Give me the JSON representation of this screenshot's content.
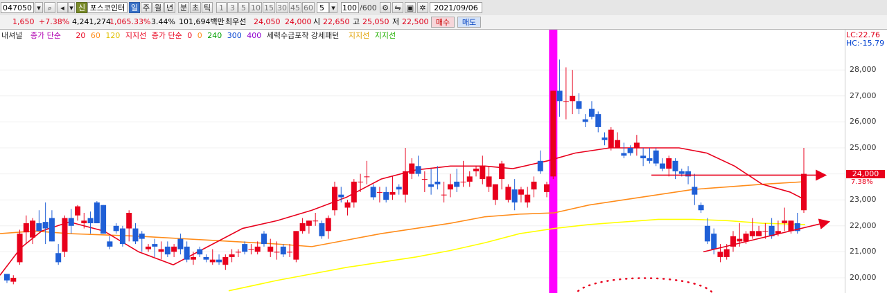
{
  "toolbar": {
    "code": "047050",
    "shin": "신",
    "name": "포스코인터",
    "periods": [
      "일",
      "주",
      "월",
      "년",
      "분",
      "초",
      "틱"
    ],
    "active_period": "일",
    "numbers": [
      "1",
      "3",
      "5",
      "10",
      "15",
      "30",
      "45",
      "60"
    ],
    "interval": "5",
    "count": "100",
    "count_total": "/600",
    "date": "2021/09/06"
  },
  "quote": {
    "change": "1,650",
    "change_pct": "+7.38%",
    "volume": "4,241,274",
    "volume_pct": "1,065.33%",
    "turnover": "3.44%",
    "amount": "101,694백만",
    "best_label": "최우선",
    "best_ask": "24,050",
    "best_bid": "24,000",
    "open_label": "시",
    "open": "22,650",
    "high_label": "고",
    "high": "25,050",
    "low_label": "저",
    "low": "22,500",
    "buy": "매수",
    "sell": "매도"
  },
  "legend": {
    "internal": "내셔널",
    "ma1_title": "종가 단순",
    "ma1_periods": [
      "20",
      "60",
      "120"
    ],
    "support1": "지지선",
    "ma2_title": "종가 단순",
    "ma2_periods": [
      "0",
      "0",
      "240",
      "300",
      "400"
    ],
    "pattern": "세력수급포착 강세패턴",
    "support2": "지지선",
    "support3": "지지선"
  },
  "axis": {
    "lc": "LC:22.76",
    "hc": "HC:-15.79",
    "current_price": "24,000",
    "current_pct": "7.38%"
  },
  "colors": {
    "up": "#e8001c",
    "down": "#1f5fd6",
    "ma20": "#e8001c",
    "ma60": "#ff8c1a",
    "ma120": "#ffff00",
    "highlight": "#ff00ff"
  },
  "chart_data": {
    "type": "candlestick",
    "y_axis_ticks": [
      "20,000",
      "21,000",
      "22,000",
      "23,000",
      "24,000",
      "25,000",
      "26,000",
      "27,000",
      "28,000"
    ],
    "ylim": [
      19400,
      29300
    ],
    "candles": [
      [
        20150,
        20150,
        19800,
        19900
      ],
      [
        19850,
        20100,
        19750,
        20000
      ],
      [
        20600,
        21850,
        20500,
        21700
      ],
      [
        21750,
        22400,
        21300,
        22100
      ],
      [
        21550,
        22300,
        21300,
        22200
      ],
      [
        22100,
        22600,
        21800,
        21800
      ],
      [
        22150,
        22900,
        21300,
        21900
      ],
      [
        22300,
        22600,
        21400,
        21400
      ],
      [
        20950,
        21300,
        20500,
        20600
      ],
      [
        21000,
        22400,
        20800,
        22300
      ],
      [
        22300,
        22650,
        21700,
        22000
      ],
      [
        22400,
        22800,
        22200,
        22750
      ],
      [
        22100,
        22500,
        21900,
        22200
      ],
      [
        22300,
        22550,
        21700,
        22100
      ],
      [
        22900,
        22950,
        22100,
        22100
      ],
      [
        22800,
        22800,
        21700,
        21700
      ],
      [
        21400,
        21600,
        21100,
        21200
      ],
      [
        22000,
        22100,
        21700,
        21800
      ],
      [
        21900,
        22000,
        21200,
        21300
      ],
      [
        21900,
        22600,
        21400,
        22500
      ],
      [
        21900,
        22100,
        21300,
        21400
      ],
      [
        21700,
        21800,
        21000,
        21500
      ],
      [
        21100,
        21300,
        21000,
        21200
      ],
      [
        21300,
        21500,
        20800,
        21200
      ],
      [
        21000,
        21400,
        20700,
        21100
      ],
      [
        21200,
        21400,
        20800,
        20900
      ],
      [
        21000,
        21300,
        20800,
        21200
      ],
      [
        21500,
        21700,
        20900,
        21100
      ],
      [
        21200,
        21400,
        20600,
        20700
      ],
      [
        20700,
        21000,
        20500,
        20800
      ],
      [
        21100,
        21200,
        20800,
        20900
      ],
      [
        20800,
        20900,
        20600,
        20700
      ],
      [
        20600,
        21100,
        20500,
        20700
      ],
      [
        20700,
        20900,
        20500,
        20600
      ],
      [
        20500,
        20900,
        20300,
        20800
      ],
      [
        20800,
        21100,
        20600,
        20900
      ],
      [
        21000,
        21100,
        20800,
        21000
      ],
      [
        21300,
        21400,
        20900,
        21000
      ],
      [
        21100,
        21300,
        20900,
        21100
      ],
      [
        21000,
        21400,
        20900,
        21200
      ],
      [
        21700,
        21800,
        21200,
        21300
      ],
      [
        21000,
        21500,
        20800,
        21200
      ],
      [
        21000,
        21400,
        20700,
        21000
      ],
      [
        21200,
        21300,
        20800,
        20900
      ],
      [
        21000,
        21300,
        20800,
        21000
      ],
      [
        20700,
        21800,
        20600,
        21800
      ],
      [
        21800,
        22300,
        21700,
        22100
      ],
      [
        22000,
        22200,
        21700,
        22200
      ],
      [
        22200,
        22500,
        22000,
        22200
      ],
      [
        22100,
        22200,
        21500,
        21600
      ],
      [
        21800,
        22400,
        21500,
        22300
      ],
      [
        22600,
        23700,
        22400,
        23500
      ],
      [
        23200,
        23500,
        22900,
        23100
      ],
      [
        22700,
        23000,
        22400,
        22900
      ],
      [
        22900,
        23800,
        22700,
        23700
      ],
      [
        23700,
        24000,
        23300,
        23700
      ],
      [
        23900,
        24500,
        23600,
        23900
      ],
      [
        23500,
        23600,
        23000,
        23100
      ],
      [
        23300,
        23500,
        22900,
        23300
      ],
      [
        23300,
        23500,
        22900,
        23000
      ],
      [
        23200,
        23900,
        23000,
        23300
      ],
      [
        23500,
        23600,
        23200,
        23400
      ],
      [
        23200,
        25000,
        22900,
        24100
      ],
      [
        24000,
        24600,
        23800,
        24400
      ],
      [
        24300,
        24700,
        23900,
        24000
      ],
      [
        23800,
        24100,
        23300,
        23800
      ],
      [
        23600,
        24200,
        23200,
        23500
      ],
      [
        23700,
        24300,
        23400,
        23600
      ],
      [
        23200,
        23700,
        22900,
        23200
      ],
      [
        23400,
        24000,
        23100,
        23600
      ],
      [
        23700,
        24200,
        23300,
        23500
      ],
      [
        23700,
        24500,
        23500,
        23700
      ],
      [
        23700,
        24100,
        23500,
        23900
      ],
      [
        24100,
        24300,
        23900,
        24200
      ],
      [
        23800,
        24700,
        23600,
        24300
      ],
      [
        23500,
        24300,
        23300,
        23900
      ],
      [
        23000,
        23600,
        22800,
        23600
      ],
      [
        23800,
        24500,
        23400,
        24400
      ],
      [
        23000,
        23600,
        22900,
        23500
      ],
      [
        23400,
        23800,
        22600,
        22900
      ],
      [
        23200,
        23500,
        22900,
        23400
      ],
      [
        22900,
        23500,
        22700,
        23200
      ],
      [
        23400,
        23900,
        23100,
        23700
      ],
      [
        24500,
        24900,
        24000,
        24100
      ],
      [
        23300,
        23700,
        23100,
        23600
      ],
      [
        23900,
        27200,
        23800,
        27200
      ],
      [
        27200,
        28400,
        26200,
        26800
      ],
      [
        26800,
        28100,
        26100,
        26800
      ],
      [
        26800,
        28000,
        26300,
        27000
      ],
      [
        26800,
        27100,
        26300,
        26500
      ],
      [
        26100,
        26300,
        25800,
        26000
      ],
      [
        26500,
        26800,
        26100,
        26200
      ],
      [
        26300,
        26400,
        25600,
        25800
      ],
      [
        25400,
        25600,
        25100,
        25300
      ],
      [
        25000,
        25800,
        24900,
        25700
      ],
      [
        25000,
        25600,
        25200,
        25300
      ],
      [
        24800,
        25200,
        24600,
        24700
      ],
      [
        25000,
        25100,
        24700,
        24800
      ],
      [
        25000,
        25500,
        24700,
        25200
      ],
      [
        24700,
        25000,
        24300,
        24600
      ],
      [
        24600,
        25000,
        24400,
        24500
      ],
      [
        24900,
        25000,
        24300,
        24400
      ],
      [
        24400,
        24600,
        24100,
        24200
      ],
      [
        24200,
        24700,
        23900,
        24600
      ],
      [
        24500,
        24600,
        23800,
        24100
      ],
      [
        24100,
        24200,
        23900,
        24000
      ],
      [
        24100,
        24300,
        23600,
        23900
      ],
      [
        23500,
        24000,
        22800,
        23200
      ],
      [
        22800,
        22900,
        22500,
        22600
      ],
      [
        22000,
        22300,
        21300,
        21400
      ],
      [
        21700,
        21900,
        20900,
        21100
      ],
      [
        20800,
        21300,
        20600,
        21000
      ],
      [
        20800,
        21300,
        20700,
        21100
      ],
      [
        21200,
        21800,
        21000,
        21600
      ],
      [
        21400,
        22100,
        21200,
        21500
      ],
      [
        21400,
        21800,
        21300,
        21700
      ],
      [
        21600,
        22300,
        21500,
        21800
      ],
      [
        21600,
        22000,
        21600,
        21800
      ],
      [
        21800,
        22100,
        21500,
        21800
      ],
      [
        22000,
        22300,
        21500,
        21600
      ],
      [
        21700,
        22200,
        21600,
        21800
      ],
      [
        22100,
        22700,
        21800,
        22200
      ],
      [
        21800,
        22200,
        21700,
        22200
      ],
      [
        22100,
        22500,
        21700,
        21800
      ],
      [
        22600,
        25000,
        22500,
        24000
      ]
    ],
    "ma20": [
      [
        0,
        20100
      ],
      [
        30,
        21150
      ],
      [
        60,
        21800
      ],
      [
        100,
        22150
      ],
      [
        150,
        21800
      ],
      [
        200,
        21000
      ],
      [
        250,
        20500
      ],
      [
        300,
        21200
      ],
      [
        350,
        21900
      ],
      [
        400,
        22200
      ],
      [
        450,
        22600
      ],
      [
        500,
        23100
      ],
      [
        550,
        23800
      ],
      [
        600,
        24150
      ],
      [
        650,
        24300
      ],
      [
        700,
        24300
      ],
      [
        740,
        24200
      ],
      [
        790,
        24500
      ],
      [
        830,
        24800
      ],
      [
        880,
        25000
      ],
      [
        930,
        25000
      ],
      [
        980,
        25000
      ],
      [
        1020,
        24800
      ],
      [
        1060,
        24300
      ],
      [
        1100,
        23600
      ],
      [
        1140,
        23300
      ],
      [
        1162,
        23000
      ]
    ],
    "ma60": [
      [
        0,
        21700
      ],
      [
        50,
        21800
      ],
      [
        100,
        21700
      ],
      [
        200,
        21600
      ],
      [
        300,
        21450
      ],
      [
        400,
        21300
      ],
      [
        450,
        21200
      ],
      [
        500,
        21450
      ],
      [
        550,
        21700
      ],
      [
        600,
        21900
      ],
      [
        650,
        22100
      ],
      [
        700,
        22350
      ],
      [
        750,
        22450
      ],
      [
        800,
        22500
      ],
      [
        850,
        22800
      ],
      [
        900,
        23000
      ],
      [
        950,
        23200
      ],
      [
        1000,
        23400
      ],
      [
        1050,
        23500
      ],
      [
        1100,
        23600
      ],
      [
        1162,
        23700
      ]
    ],
    "ma120": [
      [
        330,
        19500
      ],
      [
        400,
        19900
      ],
      [
        450,
        20150
      ],
      [
        500,
        20400
      ],
      [
        550,
        20600
      ],
      [
        600,
        20800
      ],
      [
        650,
        21050
      ],
      [
        700,
        21350
      ],
      [
        750,
        21700
      ],
      [
        800,
        21900
      ],
      [
        850,
        22050
      ],
      [
        900,
        22150
      ],
      [
        950,
        22250
      ],
      [
        1000,
        22250
      ],
      [
        1050,
        22200
      ],
      [
        1100,
        22100
      ],
      [
        1162,
        22050
      ]
    ],
    "resistance_line": [
      940,
      23950,
      1190,
      23950
    ],
    "support_line": [
      1015,
      21000,
      1195,
      22150
    ],
    "highlight_candle": 85,
    "dotted_arc": {
      "cx": 930,
      "cy": 19500,
      "rx": 100,
      "ry": 700
    }
  }
}
